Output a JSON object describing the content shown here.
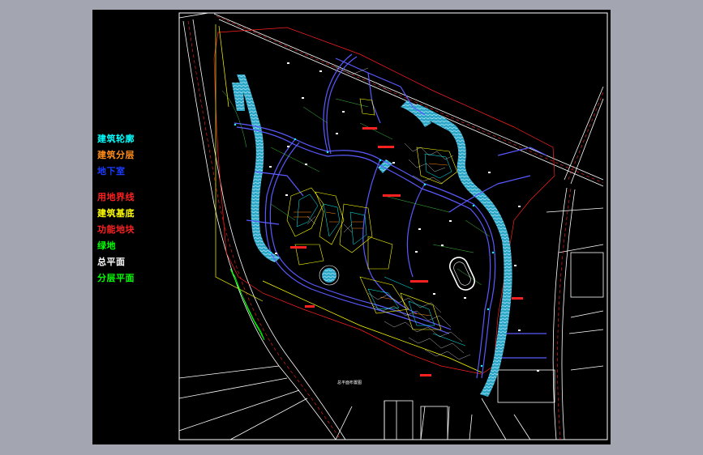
{
  "legend": {
    "items": [
      {
        "label": "建筑轮廓",
        "color": "#00ffff"
      },
      {
        "label": "建筑分层",
        "color": "#ff8c1a"
      },
      {
        "label": "地下室",
        "color": "#1a3cff"
      },
      {
        "label": "用地界线",
        "color": "#ff2020"
      },
      {
        "label": "建筑基底",
        "color": "#ffff00"
      },
      {
        "label": "功能地块",
        "color": "#ff2020"
      },
      {
        "label": "绿地",
        "color": "#00ff00"
      },
      {
        "label": "总平面",
        "color": "#ffffff"
      },
      {
        "label": "分层平面",
        "color": "#00ff00"
      }
    ]
  },
  "plan": {
    "title": "总平面布置图"
  },
  "colors": {
    "viewer_bg": "#a3a6b0",
    "canvas_bg": "#000000",
    "frame": "#ffffff",
    "water": "#2fa8c8",
    "road": "#5a5aff",
    "boundary": "#ff2020"
  }
}
